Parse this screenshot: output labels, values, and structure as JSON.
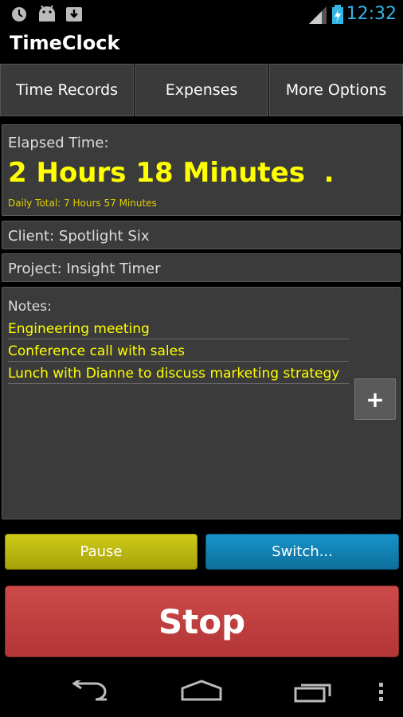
{
  "status_bar": {
    "time": "12:32",
    "icons": [
      "clock-icon",
      "android-icon",
      "download-icon",
      "signal-icon",
      "battery-charging-icon"
    ]
  },
  "app": {
    "title": "TimeClock"
  },
  "tabs": [
    {
      "label": "Time Records"
    },
    {
      "label": "Expenses"
    },
    {
      "label": "More Options"
    }
  ],
  "elapsed": {
    "label": "Elapsed Time:",
    "value": "2 Hours 18 Minutes  .",
    "daily_total": "Daily Total: 7 Hours 57 Minutes"
  },
  "client": {
    "text": "Client: Spotlight Six"
  },
  "project": {
    "text": "Project: Insight Timer"
  },
  "notes": {
    "label": "Notes:",
    "items": [
      "Engineering meeting",
      "Conference call with sales",
      "Lunch with Dianne to discuss marketing strategy"
    ],
    "add_label": "+"
  },
  "buttons": {
    "pause": "Pause",
    "switch": "Switch...",
    "stop": "Stop"
  },
  "nav_bar": {
    "icons": [
      "back-icon",
      "home-icon",
      "recent-apps-icon",
      "overflow-menu-icon"
    ]
  },
  "colors": {
    "accent_yellow": "#ffff00",
    "status_blue": "#33b5e5",
    "pause_yellow": "#bfbb12",
    "switch_blue": "#1382b3",
    "stop_red": "#c24040"
  }
}
